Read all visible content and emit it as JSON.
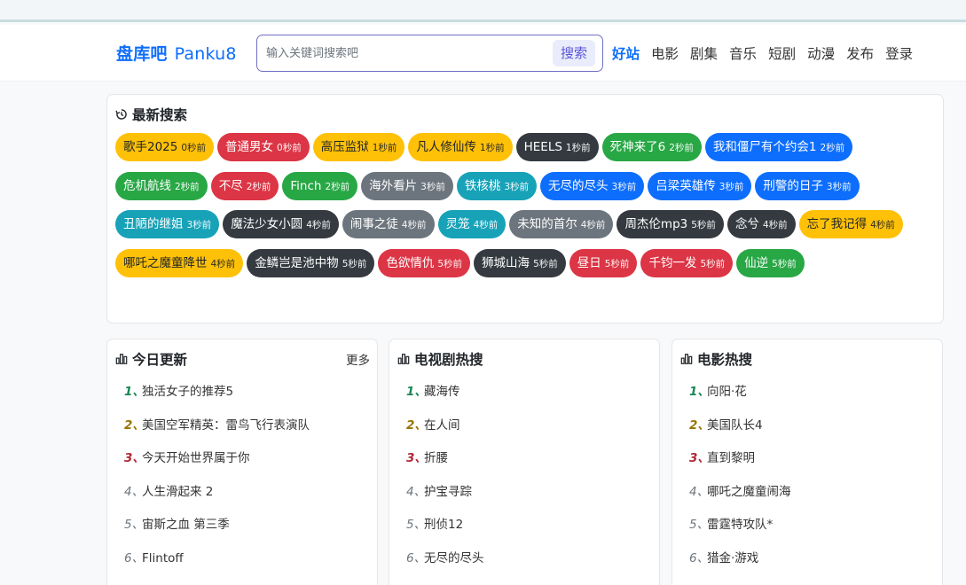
{
  "nav": {
    "brand_cn": "盘库吧",
    "brand_en": "Panku8",
    "search_placeholder": "输入关键词搜索吧",
    "search_button": "搜索",
    "links": [
      "好站",
      "电影",
      "剧集",
      "音乐",
      "短剧",
      "动漫",
      "发布",
      "登录"
    ]
  },
  "recent": {
    "title": "最新搜索",
    "icon": "history-icon",
    "tags": [
      {
        "text": "歌手2025",
        "time": "0秒前",
        "color": "warning"
      },
      {
        "text": "普通男女",
        "time": "0秒前",
        "color": "danger"
      },
      {
        "text": "高压监狱",
        "time": "1秒前",
        "color": "warning"
      },
      {
        "text": "凡人修仙传",
        "time": "1秒前",
        "color": "warning"
      },
      {
        "text": "HEELS",
        "time": "1秒前",
        "color": "dark"
      },
      {
        "text": "死神来了6",
        "time": "2秒前",
        "color": "success"
      },
      {
        "text": "我和僵尸有个约会1",
        "time": "2秒前",
        "color": "primary"
      },
      {
        "text": "危机航线",
        "time": "2秒前",
        "color": "success"
      },
      {
        "text": "不尽",
        "time": "2秒前",
        "color": "danger"
      },
      {
        "text": "Finch",
        "time": "2秒前",
        "color": "success"
      },
      {
        "text": "海外看片",
        "time": "3秒前",
        "color": "secondary"
      },
      {
        "text": "铁核桃",
        "time": "3秒前",
        "color": "info"
      },
      {
        "text": "无尽的尽头",
        "time": "3秒前",
        "color": "primary"
      },
      {
        "text": "吕梁英雄传",
        "time": "3秒前",
        "color": "primary"
      },
      {
        "text": "刑警的日子",
        "time": "3秒前",
        "color": "primary"
      },
      {
        "text": "丑陋的继姐",
        "time": "3秒前",
        "color": "info"
      },
      {
        "text": "魔法少女小圆",
        "time": "4秒前",
        "color": "dark"
      },
      {
        "text": "闹事之徒",
        "time": "4秒前",
        "color": "secondary"
      },
      {
        "text": "灵笼",
        "time": "4秒前",
        "color": "info"
      },
      {
        "text": "未知的首尔",
        "time": "4秒前",
        "color": "secondary"
      },
      {
        "text": "周杰伦mp3",
        "time": "5秒前",
        "color": "dark"
      },
      {
        "text": "念兮",
        "time": "4秒前",
        "color": "dark"
      },
      {
        "text": "忘了我记得",
        "time": "4秒前",
        "color": "warning"
      },
      {
        "text": "哪吒之魔童降世",
        "time": "4秒前",
        "color": "warning"
      },
      {
        "text": "金鳞岂是池中物",
        "time": "5秒前",
        "color": "dark"
      },
      {
        "text": "色欲情仇",
        "time": "5秒前",
        "color": "danger"
      },
      {
        "text": "狮城山海",
        "time": "5秒前",
        "color": "dark"
      },
      {
        "text": "昼日",
        "time": "5秒前",
        "color": "danger"
      },
      {
        "text": "千钧一发",
        "time": "5秒前",
        "color": "danger"
      },
      {
        "text": "仙逆",
        "time": "5秒前",
        "color": "success"
      }
    ]
  },
  "panels": [
    {
      "title": "今日更新",
      "more": "更多",
      "icon": "chart-icon",
      "items": [
        "独活女子的推荐5",
        "美国空军精英：雷鸟飞行表演队",
        "今天开始世界属于你",
        "人生滑起来 2",
        "宙斯之血 第三季",
        "Flintoff"
      ]
    },
    {
      "title": "电视剧热搜",
      "icon": "chart-icon",
      "items": [
        "藏海传",
        "在人间",
        "折腰",
        "护宝寻踪",
        "刑侦12",
        "无尽的尽头"
      ]
    },
    {
      "title": "电影热搜",
      "icon": "chart-icon",
      "items": [
        "向阳·花",
        "美国队长4",
        "直到黎明",
        "哪吒之魔童闹海",
        "雷霆特攻队*",
        "猎金·游戏"
      ]
    }
  ],
  "colors": {
    "primary": "#0d6efd",
    "secondary": "#6c757d",
    "success": "#28a745",
    "danger": "#dc3545",
    "warning": "#ffc107",
    "info": "#17a2b8",
    "dark": "#343a40"
  }
}
